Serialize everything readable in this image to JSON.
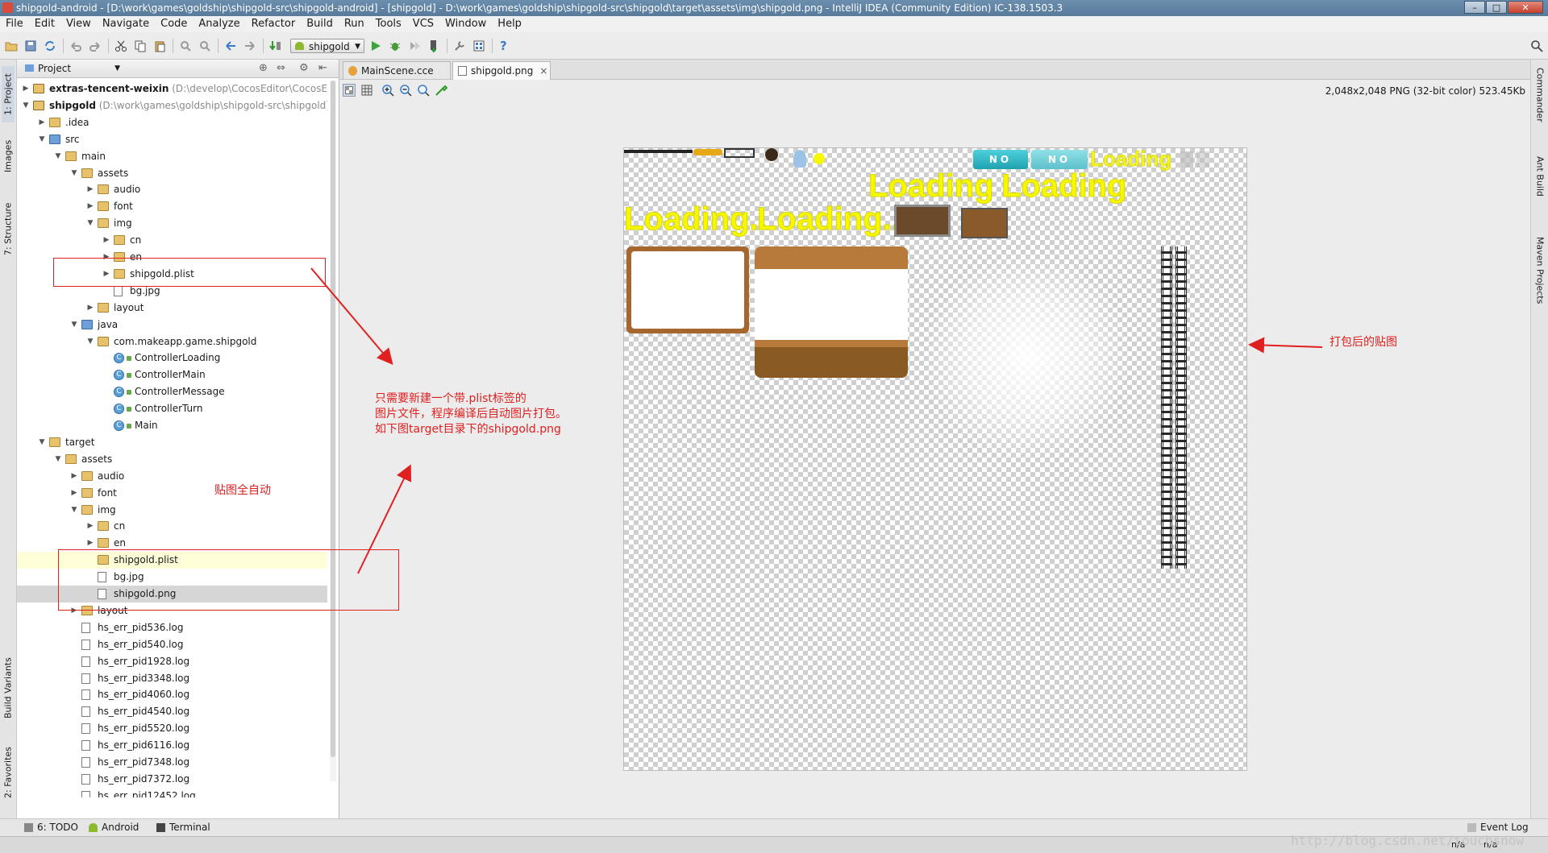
{
  "window": {
    "title": "shipgold-android - [D:\\work\\games\\goldship\\shipgold-src\\shipgold-android] - [shipgold] - D:\\work\\games\\goldship\\shipgold-src\\shipgold\\target\\assets\\img\\shipgold.png - IntelliJ IDEA (Community Edition) IC-138.1503.3",
    "min": "–",
    "max": "□",
    "close": "✕"
  },
  "menu": [
    "File",
    "Edit",
    "View",
    "Navigate",
    "Code",
    "Analyze",
    "Refactor",
    "Build",
    "Run",
    "Tools",
    "VCS",
    "Window",
    "Help"
  ],
  "toolbar": {
    "run_config": "shipgold",
    "help": "?"
  },
  "left_stripe": {
    "project": "1: Project",
    "images": "Images",
    "structure": "7: Structure",
    "build_variants": "Build Variants",
    "favorites": "2: Favorites"
  },
  "right_stripe": {
    "commander": "Commander",
    "ant": "Ant Build",
    "maven": "Maven Projects"
  },
  "project_panel": {
    "view": "Project"
  },
  "tree": [
    {
      "label": "extras-tencent-weixin",
      "loc": " (D:\\develop\\CocosEditor\\CocosEdit",
      "bold": true
    },
    {
      "label": "shipgold",
      "loc": " (D:\\work\\games\\goldship\\shipgold-src\\shipgold)",
      "bold": true
    },
    {
      "label": ".idea"
    },
    {
      "label": "src"
    },
    {
      "label": "main"
    },
    {
      "label": "assets"
    },
    {
      "label": "audio"
    },
    {
      "label": "font"
    },
    {
      "label": "img"
    },
    {
      "label": "cn"
    },
    {
      "label": "en"
    },
    {
      "label": "shipgold.plist"
    },
    {
      "label": "bg.jpg"
    },
    {
      "label": "layout"
    },
    {
      "label": "java"
    },
    {
      "label": "com.makeapp.game.shipgold"
    },
    {
      "label": "ControllerLoading"
    },
    {
      "label": "ControllerMain"
    },
    {
      "label": "ControllerMessage"
    },
    {
      "label": "ControllerTurn"
    },
    {
      "label": "Main"
    },
    {
      "label": "target"
    },
    {
      "label": "assets"
    },
    {
      "label": "audio"
    },
    {
      "label": "font"
    },
    {
      "label": "img"
    },
    {
      "label": "cn"
    },
    {
      "label": "en"
    },
    {
      "label": "shipgold.plist"
    },
    {
      "label": "bg.jpg"
    },
    {
      "label": "shipgold.png"
    },
    {
      "label": "layout"
    },
    {
      "label": "hs_err_pid536.log"
    },
    {
      "label": "hs_err_pid540.log"
    },
    {
      "label": "hs_err_pid1928.log"
    },
    {
      "label": "hs_err_pid3348.log"
    },
    {
      "label": "hs_err_pid4060.log"
    },
    {
      "label": "hs_err_pid4540.log"
    },
    {
      "label": "hs_err_pid5520.log"
    },
    {
      "label": "hs_err_pid6116.log"
    },
    {
      "label": "hs_err_pid7348.log"
    },
    {
      "label": "hs_err_pid7372.log"
    },
    {
      "label": "hs_err_pid12452.log"
    }
  ],
  "editor_tabs": [
    {
      "label": "MainScene.cce",
      "close": "×"
    },
    {
      "label": "shipgold.png",
      "close": "×"
    }
  ],
  "image_info": "2,048x2,048 PNG (32-bit color) 523.45Kb",
  "atlas": {
    "loading": [
      "Loading",
      "Loading",
      "Loading",
      "Loading..",
      "Loading..."
    ],
    "no_buttons": [
      "NO",
      "NO"
    ]
  },
  "annotations": {
    "note_plist_lines": [
      "只需要新建一个带.plist标签的",
      "图片文件，程序编译后自动图片打包。",
      "如下图target目录下的shipgold.png"
    ],
    "note_auto": "贴图全自动",
    "note_packed": "打包后的贴图",
    "color": "#e02020"
  },
  "bottom_tabs": [
    {
      "label": "6: TODO"
    },
    {
      "label": "Android"
    },
    {
      "label": "Terminal"
    }
  ],
  "event_log": "Event Log",
  "status": {
    "pos1": "n/a",
    "pos2": "n/a"
  },
  "watermark": "http://blog.csdn.net/touchsnow"
}
